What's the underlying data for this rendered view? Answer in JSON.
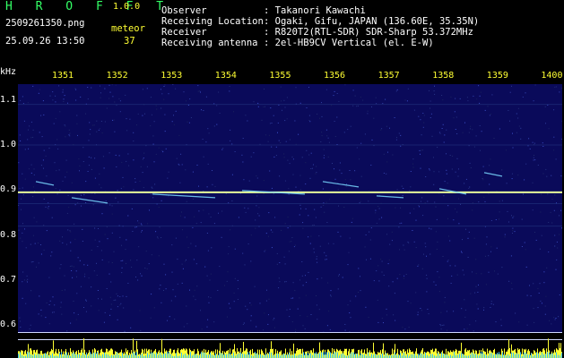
{
  "header": {
    "title": "H R O F F T",
    "version": "1.0.0",
    "filename": "2509261350.png",
    "datetime": "25.09.26 13:50",
    "meteor_label": "meteor",
    "meteor_count": "37",
    "labels": {
      "observer": "Observer",
      "location": "Receiving Location",
      "receiver": "Receiver",
      "antenna": "Receiving antenna"
    },
    "values": {
      "observer": ": Takanori Kawachi",
      "location": ": Ogaki, Gifu, JAPAN (136.60E, 35.35N)",
      "receiver": ": R820T2(RTL-SDR) SDR-Sharp 53.372MHz",
      "antenna": ": 2el-HB9CV Vertical (el. E-W)"
    }
  },
  "chart_data": {
    "type": "heatmap",
    "ylabel": "kHz",
    "x_ticks": [
      "1351",
      "1352",
      "1353",
      "1354",
      "1355",
      "1356",
      "1357",
      "1358",
      "1359",
      "1400"
    ],
    "y_ticks": [
      "1.1",
      "1.0",
      "0.9",
      "0.8",
      "0.7",
      "0.6"
    ],
    "ylim": [
      0.6,
      1.1
    ],
    "carrier_khz": 0.895,
    "colors": {
      "background": "#0a0a5a",
      "carrier": "#e8ff9a",
      "meteor": "#7ad8ff",
      "tick": "#ffff33",
      "strip": "#ffff33"
    }
  }
}
